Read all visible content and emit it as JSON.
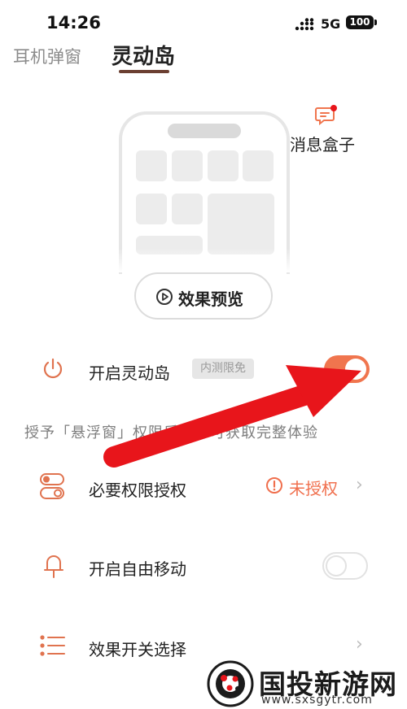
{
  "status_bar": {
    "time": "14:26",
    "network": "5G",
    "battery": "100"
  },
  "tabs": [
    {
      "label": "耳机弹窗",
      "active": false
    },
    {
      "label": "灵动岛",
      "active": true
    }
  ],
  "message_box": {
    "label": "消息盒子",
    "icon": "message-icon"
  },
  "preview_button": {
    "label": "效果预览",
    "icon": "play-circle-icon"
  },
  "island_row": {
    "label": "开启灵动岛",
    "badge": "内测限免",
    "toggle_on": true,
    "icon": "power-icon"
  },
  "hint_text": "授予「悬浮窗」权限后，方可获取完整体验",
  "permission_row": {
    "label": "必要权限授权",
    "status": "未授权",
    "icon": "toggles-icon"
  },
  "free_move_row": {
    "label": "开启自由移动",
    "toggle_on": false,
    "icon": "bell-icon"
  },
  "effect_row": {
    "label": "效果开关选择",
    "icon": "list-icon"
  },
  "colors": {
    "accent": "#f0754e",
    "tab_underline": "#6b3f31",
    "arrow": "#e8151b"
  },
  "watermark": {
    "name": "国投新游网",
    "url": "www.sxsgytr.com"
  }
}
